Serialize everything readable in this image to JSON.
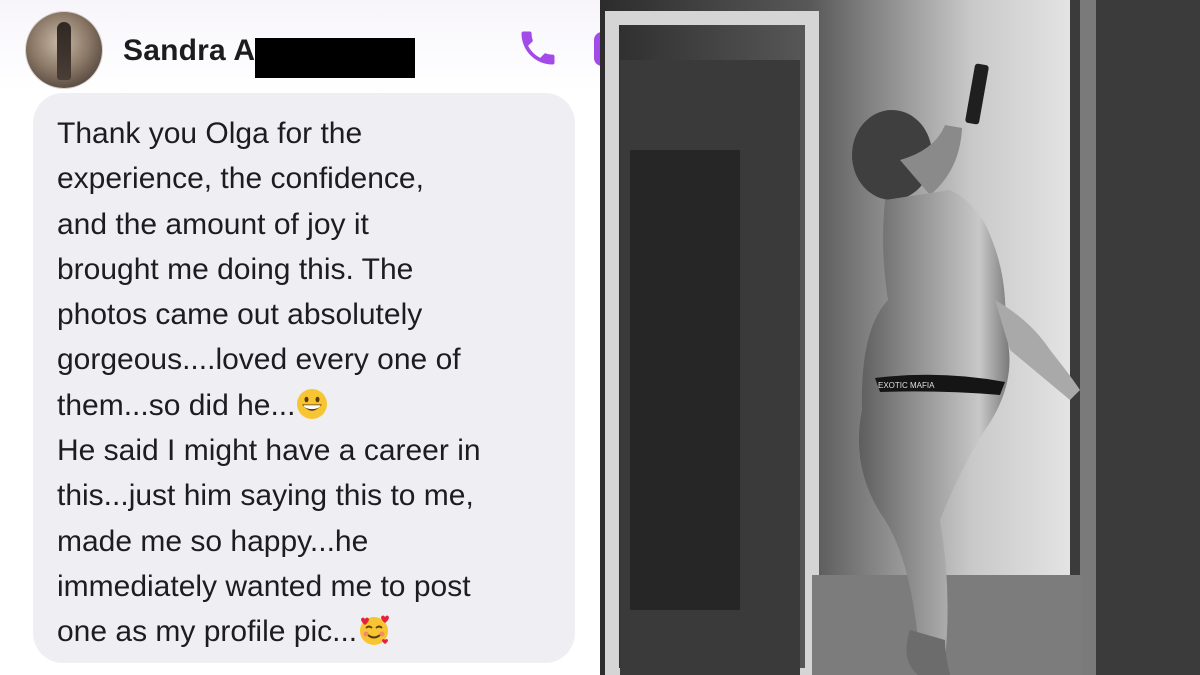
{
  "contact": {
    "name": "Sandra A",
    "avatar_icon": "profile-photo",
    "call_icon": "phone-icon",
    "video_icon": "video-icon",
    "accent_color": "#a24be8"
  },
  "message": {
    "lines": [
      "Thank you Olga for the",
      "experience,  the confidence,",
      "and the amount of joy it",
      "brought me doing this. The",
      "photos came out absolutely",
      "gorgeous....loved every one of",
      "them...so did he...",
      "He said I might have a career in",
      "this...just him saying this to me,",
      "made me so happy...he",
      "immediately wanted me to post",
      "one as my profile pic..."
    ],
    "emoji_after_line_7": "grinning-face-emoji",
    "emoji_after_line_12": "smiling-face-with-hearts-emoji",
    "bubble_color": "#efeef3"
  },
  "photo": {
    "style": "black-and-white",
    "waistband_text": "EXOTIC MAFIA"
  }
}
